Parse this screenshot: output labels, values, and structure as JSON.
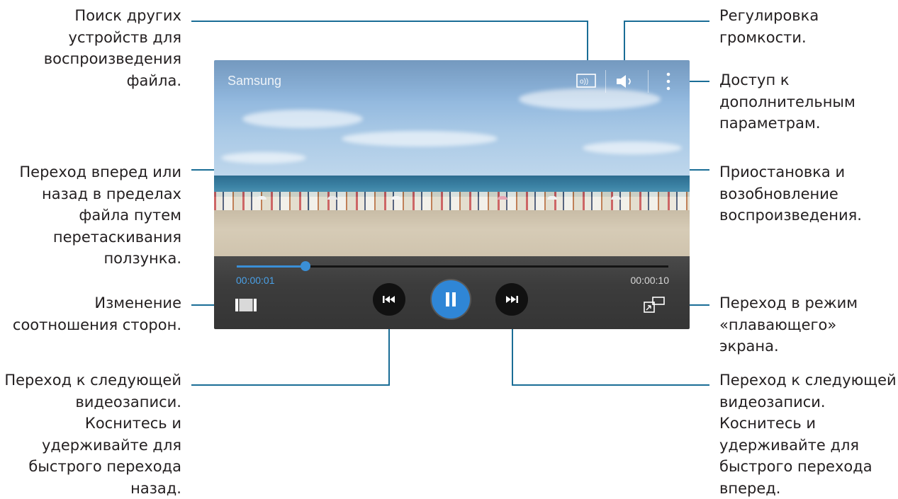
{
  "player": {
    "title": "Samsung",
    "current_time": "00:00:01",
    "total_time": "00:00:10",
    "progress": 0.16,
    "accent_color": "#3a8fd6",
    "icons": {
      "cast": "cast-devices-icon",
      "volume": "volume-icon",
      "more": "more-options-icon",
      "ratio": "aspect-ratio-icon",
      "prev": "previous-icon",
      "pause": "pause-icon",
      "next": "next-icon",
      "popup": "popup-screen-icon"
    }
  },
  "callouts": {
    "search_devices": "Поиск других\nустройств для\nвоспроизведения\nфайла.",
    "seek": "Переход вперед или\nназад в пределах\nфайла путем\nперетаскивания\nползунка.",
    "aspect_ratio": "Изменение\nсоотношения сторон.",
    "prev_video": "Переход к следующей\nвидеозаписи.\nКоснитесь и\nудерживайте для\nбыстрого перехода\nназад.",
    "volume": "Регулировка\nгромкости.",
    "more_options": "Доступ к\nдополнительным\nпараметрам.",
    "pause_resume": "Приостановка и\nвозобновление\nвоспроизведения.",
    "popup_mode": "Переход в режим\n«плавающего» экрана.",
    "next_video": "Переход к следующей\nвидеозаписи.\nКоснитесь и\nудерживайте для\nбыстрого перехода\nвперед."
  }
}
